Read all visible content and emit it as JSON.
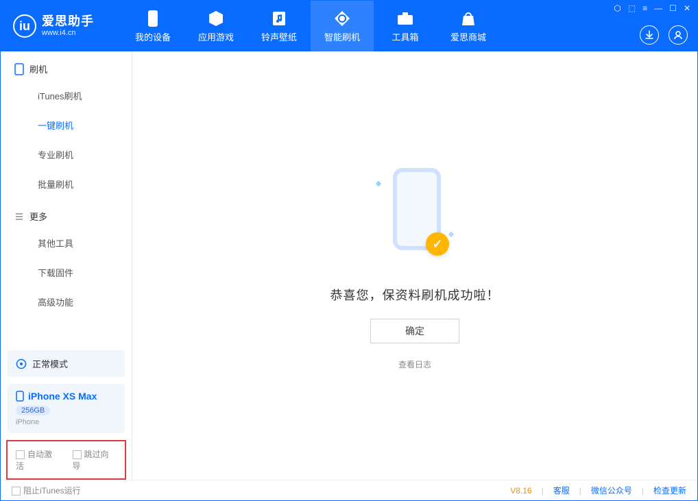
{
  "logo": {
    "cn": "爱思助手",
    "url": "www.i4.cn"
  },
  "window_controls": {
    "skin": "⬚",
    "menu": "≡",
    "min": "—",
    "max": "☐",
    "close": "✕",
    "extra": "⬡"
  },
  "tabs": [
    {
      "label": "我的设备",
      "icon": "device-icon"
    },
    {
      "label": "应用游戏",
      "icon": "cube-icon"
    },
    {
      "label": "铃声壁纸",
      "icon": "music-icon"
    },
    {
      "label": "智能刷机",
      "icon": "refresh-icon",
      "active": true
    },
    {
      "label": "工具箱",
      "icon": "toolbox-icon"
    },
    {
      "label": "爱思商城",
      "icon": "bag-icon"
    }
  ],
  "header_buttons": {
    "download": "↓",
    "user": "user"
  },
  "sidebar": {
    "groups": [
      {
        "icon": "phone-icon",
        "title": "刷机",
        "items": [
          {
            "label": "iTunes刷机"
          },
          {
            "label": "一键刷机",
            "active": true
          },
          {
            "label": "专业刷机"
          },
          {
            "label": "批量刷机"
          }
        ]
      },
      {
        "icon": "more-icon",
        "title": "更多",
        "items": [
          {
            "label": "其他工具"
          },
          {
            "label": "下载固件"
          },
          {
            "label": "高级功能"
          }
        ]
      }
    ],
    "mode": "正常模式",
    "device": {
      "name": "iPhone XS Max",
      "capacity": "256GB",
      "type": "iPhone"
    },
    "options": {
      "auto_activate": "自动激活",
      "skip_guide": "跳过向导"
    }
  },
  "content": {
    "message": "恭喜您，保资料刷机成功啦！",
    "ok": "确定",
    "view_log": "查看日志"
  },
  "footer": {
    "block_itunes": "阻止iTunes运行",
    "version": "V8.16",
    "links": {
      "support": "客服",
      "wechat": "微信公众号",
      "update": "检查更新"
    }
  }
}
